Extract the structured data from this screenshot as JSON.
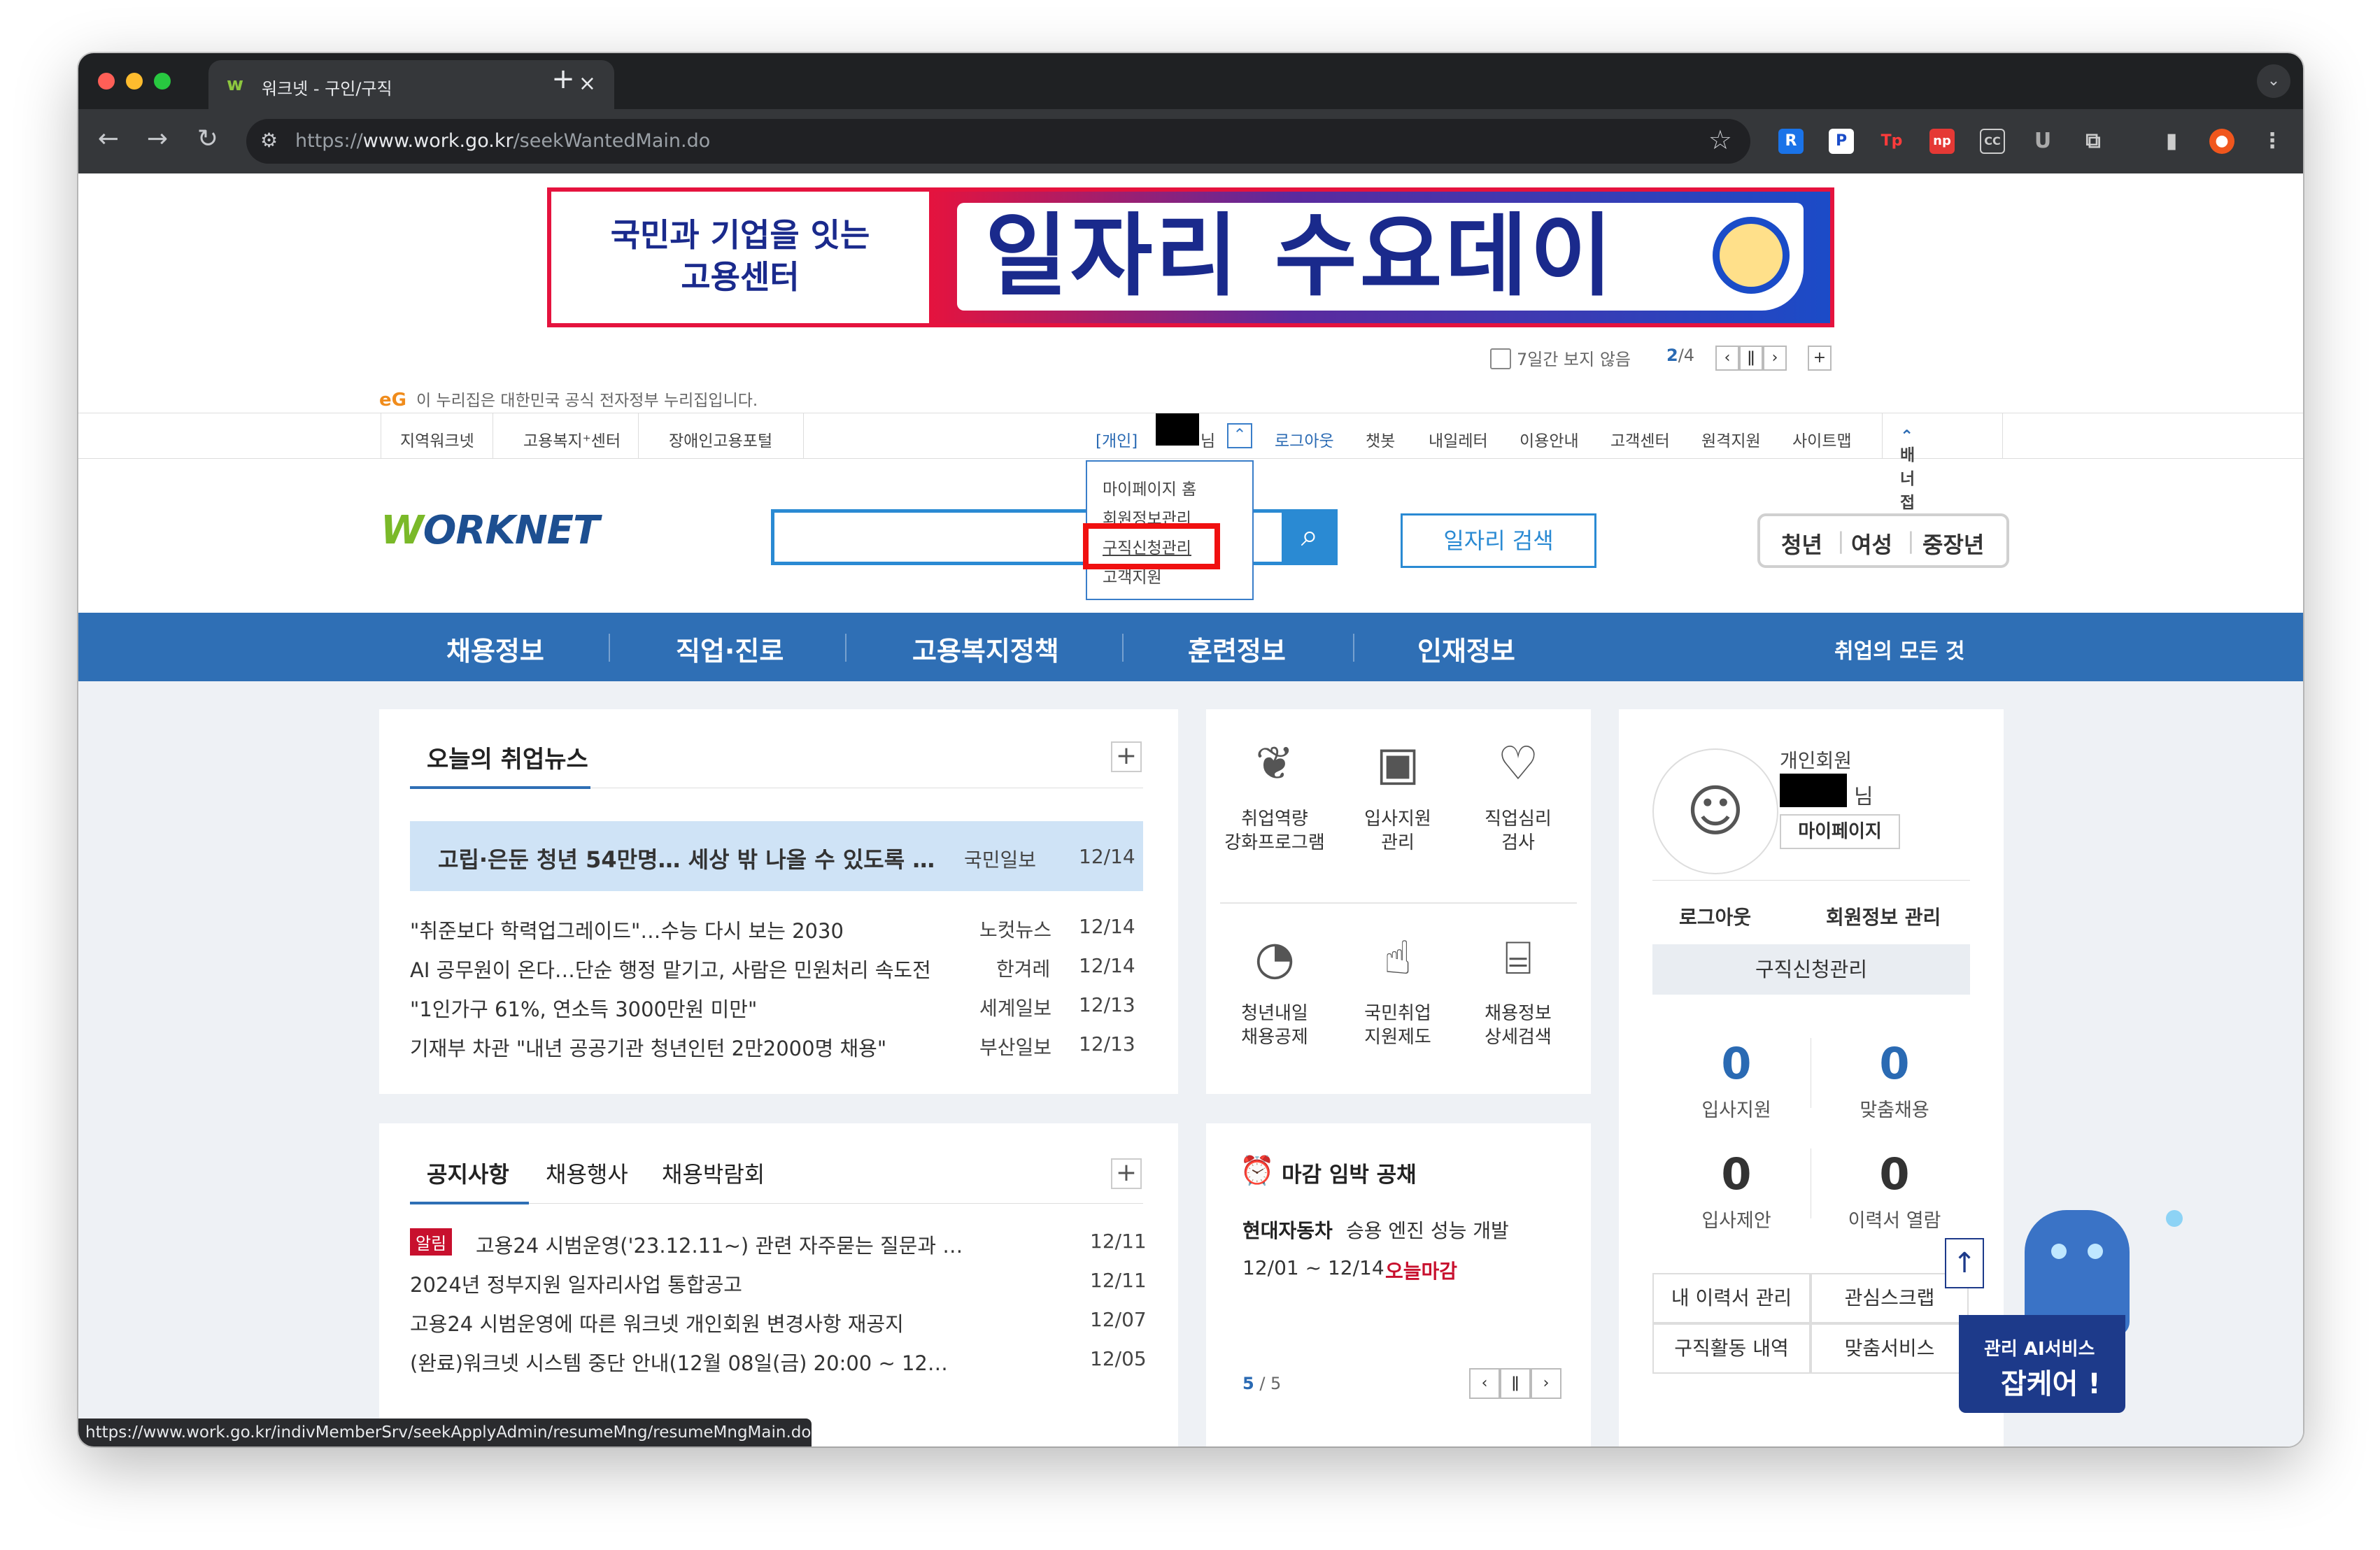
{
  "browser": {
    "tab_title": "워크넷 - 구인/구직",
    "tab_favicon": "w",
    "url_prefix": "https://",
    "url_domain": "www.work.go.kr",
    "url_path": "/seekWantedMain.do",
    "extensions": [
      "R",
      "P",
      "Tp",
      "np",
      "CC",
      "U"
    ],
    "status_url": "https://www.work.go.kr/indivMemberSrv/seekApplyAdmin/resumeMng/resumeMngMain.do"
  },
  "banner": {
    "left_line1": "국민과 기업을 잇는",
    "left_line2": "고용센터",
    "headline": "일자리 수요데이",
    "hide_7days": "7일간 보지 않음",
    "page_current": "2",
    "page_total": "/4"
  },
  "egov": {
    "mark": "eG",
    "notice": "이 누리집은 대한민국 공식 전자정부 누리집입니다."
  },
  "util": {
    "left_links": [
      "지역워크넷",
      "고용복지⁺센터",
      "장애인고용포털"
    ],
    "user_type": "[개인]",
    "user_suffix": "님",
    "right_links": [
      "로그아웃",
      "챗봇",
      "내일레터",
      "이용안내",
      "고객센터",
      "원격지원",
      "사이트맵"
    ],
    "banner_fold": "배너 접기"
  },
  "dropdown": [
    "마이페이지 홈",
    "회원정보관리",
    "구직신청관리",
    "고객지원"
  ],
  "header": {
    "logo_w": "W",
    "logo_rest": "ORKNET",
    "search_placeholder": "",
    "job_search": "일자리 검색",
    "age_groups": [
      "청년",
      "여성",
      "중장년"
    ]
  },
  "gnb": {
    "items": [
      "채용정보",
      "직업·진로",
      "고용복지정책",
      "훈련정보",
      "인재정보"
    ],
    "right": "취업의 모든 것"
  },
  "news": {
    "title": "오늘의 취업뉴스",
    "headline": {
      "text": "고립·은둔 청년 54만명… 세상 밖 나올 수 있도록 …",
      "source": "국민일보",
      "date": "12/14"
    },
    "items": [
      {
        "text": "\"취준보다 학력업그레이드\"…수능 다시 보는 2030",
        "source": "노컷뉴스",
        "date": "12/14"
      },
      {
        "text": "AI 공무원이 온다…단순 행정 맡기고, 사람은 민원처리 속도전",
        "source": "한겨레",
        "date": "12/14"
      },
      {
        "text": "\"1인가구 61%, 연소득 3000만원 미만\"",
        "source": "세계일보",
        "date": "12/13"
      },
      {
        "text": "기재부 차관 \"내년 공공기관 청년인턴 2만2000명 채용\"",
        "source": "부산일보",
        "date": "12/13"
      }
    ]
  },
  "services": [
    {
      "icon": "sprout-icon",
      "line1": "취업역량",
      "line2": "강화프로그램"
    },
    {
      "icon": "id-card-icon",
      "line1": "입사지원",
      "line2": "관리"
    },
    {
      "icon": "heart-check-icon",
      "line1": "직업심리",
      "line2": "검사"
    },
    {
      "icon": "piggy-bank-icon",
      "line1": "청년내일",
      "line2": "채용공제"
    },
    {
      "icon": "thumbs-up-icon",
      "line1": "국민취업",
      "line2": "지원제도"
    },
    {
      "icon": "document-search-icon",
      "line1": "채용정보",
      "line2": "상세검색"
    }
  ],
  "profile": {
    "member_type": "개인회원",
    "name_suffix": "님",
    "mypage": "마이페이지",
    "logout": "로그아웃",
    "member_info": "회원정보 관리",
    "apply_manage": "구직신청관리",
    "stats": [
      {
        "value": "0",
        "label": "입사지원"
      },
      {
        "value": "0",
        "label": "맞춤채용"
      },
      {
        "value": "0",
        "label": "입사제안"
      },
      {
        "value": "0",
        "label": "이력서 열람"
      }
    ],
    "buttons": [
      "내 이력서 관리",
      "관심스크랩",
      "구직활동 내역",
      "맞춤서비스"
    ]
  },
  "notice": {
    "tabs": [
      "공지사항",
      "채용행사",
      "채용박람회"
    ],
    "alert_badge": "알림",
    "items": [
      {
        "text": "고용24 시범운영('23.12.11~) 관련 자주묻는 질문과 …",
        "date": "12/11"
      },
      {
        "text": "2024년 정부지원 일자리사업 통합공고",
        "date": "12/11"
      },
      {
        "text": "고용24 시범운영에 따른 워크넷 개인회원 변경사항 재공지",
        "date": "12/07"
      },
      {
        "text": "(완료)워크넷 시스템 중단 안내(12월 08일(금) 20:00 ~ 12…",
        "date": "12/05"
      }
    ]
  },
  "deadline": {
    "title": "마감 임박 공채",
    "company": "현대자동차",
    "job": "승용 엔진 성능 개발",
    "period": "12/01 ~ 12/14",
    "status": "오늘마감",
    "page_current": "5",
    "page_total": " / 5"
  },
  "robot": {
    "line1": "관리 AI서비스",
    "line2": "잡케어 !"
  },
  "colors": {
    "primary": "#2f6fb5",
    "accent": "#2a8ad3",
    "alert": "#c8102e",
    "highlight": "#cfe3f6"
  }
}
